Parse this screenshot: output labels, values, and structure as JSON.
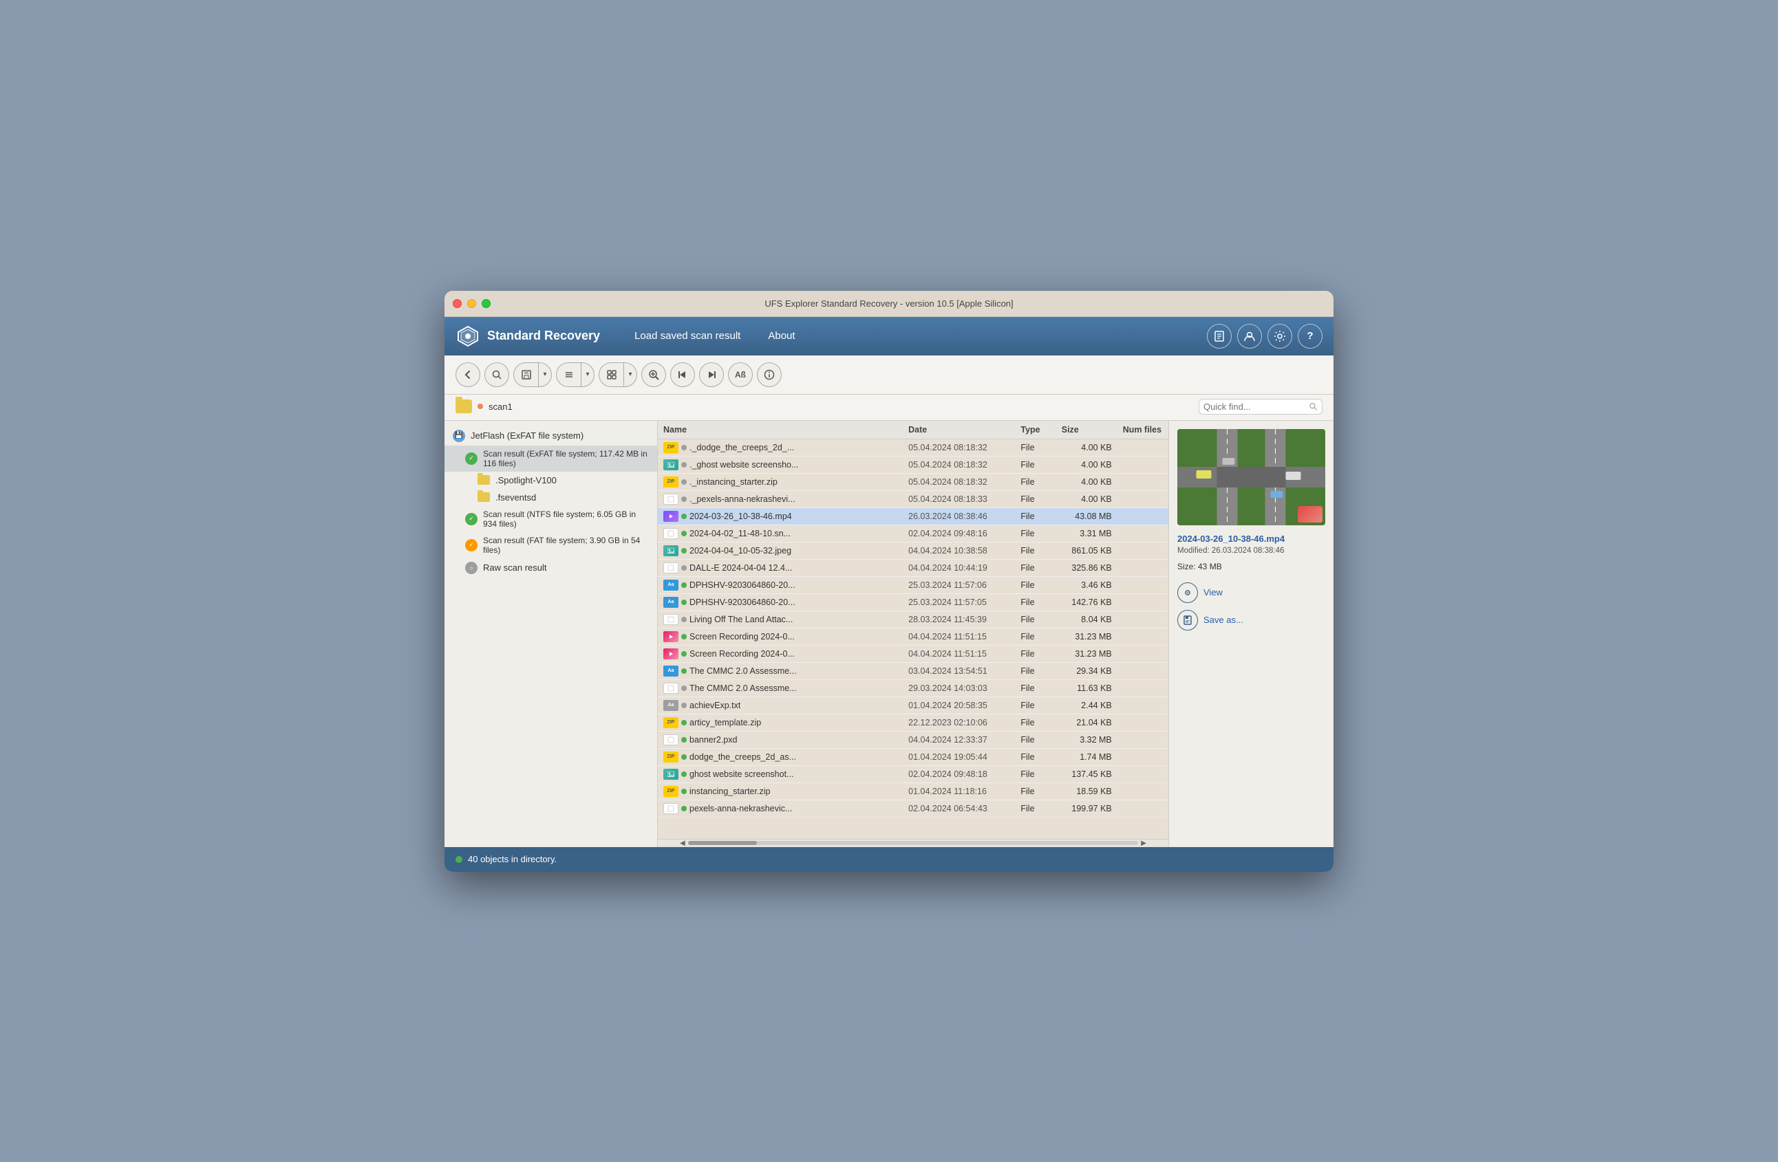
{
  "window": {
    "title": "UFS Explorer Standard Recovery - version 10.5 [Apple Silicon]"
  },
  "menubar": {
    "logo_text": "Standard Recovery",
    "items": [
      {
        "id": "load-scan",
        "label": "Load saved scan result"
      },
      {
        "id": "about",
        "label": "About"
      }
    ],
    "right_icons": [
      {
        "id": "docs-icon",
        "symbol": "📋"
      },
      {
        "id": "user-icon",
        "symbol": "👤"
      },
      {
        "id": "settings-icon",
        "symbol": "⚙"
      },
      {
        "id": "help-icon",
        "symbol": "?"
      }
    ]
  },
  "toolbar": {
    "buttons": [
      {
        "id": "back-btn",
        "symbol": "←"
      },
      {
        "id": "search-btn",
        "symbol": "🔍"
      },
      {
        "id": "save-btn",
        "symbol": "💾"
      },
      {
        "id": "list-btn",
        "symbol": "☰"
      },
      {
        "id": "view-btn",
        "symbol": "⊞"
      },
      {
        "id": "find-btn",
        "symbol": "🔎"
      },
      {
        "id": "prev-btn",
        "symbol": "⏮"
      },
      {
        "id": "next-btn",
        "symbol": "⏭"
      },
      {
        "id": "font-btn",
        "symbol": "Aß"
      },
      {
        "id": "info-btn",
        "symbol": "ℹ"
      }
    ]
  },
  "pathbar": {
    "path_name": "scan1",
    "search_placeholder": "Quick find..."
  },
  "sidebar": {
    "items": [
      {
        "id": "jetflash",
        "label": "JetFlash (ExFAT file system)",
        "icon_type": "disk",
        "indent": 0
      },
      {
        "id": "scan-exfat",
        "label": "Scan result (ExFAT file system; 117.42 MB in 116 files)",
        "icon_type": "green",
        "indent": 1
      },
      {
        "id": "spotlight",
        "label": ".Spotlight-V100",
        "icon_type": "folder",
        "indent": 2
      },
      {
        "id": "fseventsd",
        "label": ".fseventsd",
        "icon_type": "folder",
        "indent": 2
      },
      {
        "id": "scan-ntfs",
        "label": "Scan result (NTFS file system; 6.05 GB in 934 files)",
        "icon_type": "green",
        "indent": 1
      },
      {
        "id": "scan-fat",
        "label": "Scan result (FAT file system; 3.90 GB in 54 files)",
        "icon_type": "orange",
        "indent": 1
      },
      {
        "id": "raw-scan",
        "label": "Raw scan result",
        "icon_type": "gray",
        "indent": 1
      }
    ]
  },
  "file_table": {
    "columns": [
      "Name",
      "Date",
      "Type",
      "Size",
      "Num files"
    ],
    "rows": [
      {
        "name": "._dodge_the_creeps_2d_...",
        "thumb": "zip",
        "date": "05.04.2024 08:18:32",
        "type": "File",
        "size": "4.00 KB",
        "num_files": "",
        "dot": "gray",
        "selected": false
      },
      {
        "name": "._ghost website screensho...",
        "thumb": "photo",
        "date": "05.04.2024 08:18:32",
        "type": "File",
        "size": "4.00 KB",
        "num_files": "",
        "dot": "gray",
        "selected": false
      },
      {
        "name": "._instancing_starter.zip",
        "thumb": "zip",
        "date": "05.04.2024 08:18:32",
        "type": "File",
        "size": "4.00 KB",
        "num_files": "",
        "dot": "gray",
        "selected": false
      },
      {
        "name": "._pexels-anna-nekrashevi...",
        "thumb": "doc",
        "date": "05.04.2024 08:18:33",
        "type": "File",
        "size": "4.00 KB",
        "num_files": "",
        "dot": "gray",
        "selected": false
      },
      {
        "name": "2024-03-26_10-38-46.mp4",
        "thumb": "video",
        "date": "26.03.2024 08:38:46",
        "type": "File",
        "size": "43.08 MB",
        "num_files": "",
        "dot": "green",
        "selected": true
      },
      {
        "name": "2024-04-02_11-48-10.sn...",
        "thumb": "doc",
        "date": "02.04.2024 09:48:16",
        "type": "File",
        "size": "3.31 MB",
        "num_files": "",
        "dot": "green",
        "selected": false
      },
      {
        "name": "2024-04-04_10-05-32.jpeg",
        "thumb": "photo",
        "date": "04.04.2024 10:38:58",
        "type": "File",
        "size": "861.05 KB",
        "num_files": "",
        "dot": "green",
        "selected": false
      },
      {
        "name": "DALL-E 2024-04-04 12.4...",
        "thumb": "doc",
        "date": "04.04.2024 10:44:19",
        "type": "File",
        "size": "325.86 KB",
        "num_files": "",
        "dot": "gray",
        "selected": false
      },
      {
        "name": "DPHSHV-9203064860-20...",
        "thumb": "aa",
        "date": "25.03.2024 11:57:06",
        "type": "File",
        "size": "3.46 KB",
        "num_files": "",
        "dot": "green",
        "selected": false
      },
      {
        "name": "DPHSHV-9203064860-20...",
        "thumb": "aa",
        "date": "25.03.2024 11:57:05",
        "type": "File",
        "size": "142.76 KB",
        "num_files": "",
        "dot": "green",
        "selected": false
      },
      {
        "name": "Living Off The Land Attac...",
        "thumb": "doc",
        "date": "28.03.2024 11:45:39",
        "type": "File",
        "size": "8.04 KB",
        "num_files": "",
        "dot": "gray",
        "selected": false
      },
      {
        "name": "Screen Recording 2024-0...",
        "thumb": "video-pink",
        "date": "04.04.2024 11:51:15",
        "type": "File",
        "size": "31.23 MB",
        "num_files": "",
        "dot": "green",
        "selected": false
      },
      {
        "name": "Screen Recording 2024-0...",
        "thumb": "video-pink",
        "date": "04.04.2024 11:51:15",
        "type": "File",
        "size": "31.23 MB",
        "num_files": "",
        "dot": "green",
        "selected": false
      },
      {
        "name": "The CMMC 2.0 Assessme...",
        "thumb": "aa",
        "date": "03.04.2024 13:54:51",
        "type": "File",
        "size": "29.34 KB",
        "num_files": "",
        "dot": "green",
        "selected": false
      },
      {
        "name": "The CMMC 2.0 Assessme...",
        "thumb": "doc",
        "date": "29.03.2024 14:03:03",
        "type": "File",
        "size": "11.63 KB",
        "num_files": "",
        "dot": "gray",
        "selected": false
      },
      {
        "name": "achievExp.txt",
        "thumb": "aa-gray",
        "date": "01.04.2024 20:58:35",
        "type": "File",
        "size": "2.44 KB",
        "num_files": "",
        "dot": "gray",
        "selected": false
      },
      {
        "name": "articy_template.zip",
        "thumb": "zip",
        "date": "22.12.2023 02:10:06",
        "type": "File",
        "size": "21.04 KB",
        "num_files": "",
        "dot": "green",
        "selected": false
      },
      {
        "name": "banner2.pxd",
        "thumb": "doc",
        "date": "04.04.2024 12:33:37",
        "type": "File",
        "size": "3.32 MB",
        "num_files": "",
        "dot": "green",
        "selected": false
      },
      {
        "name": "dodge_the_creeps_2d_as...",
        "thumb": "zip",
        "date": "01.04.2024 19:05:44",
        "type": "File",
        "size": "1.74 MB",
        "num_files": "",
        "dot": "green",
        "selected": false
      },
      {
        "name": "ghost website screenshot...",
        "thumb": "photo",
        "date": "02.04.2024 09:48:18",
        "type": "File",
        "size": "137.45 KB",
        "num_files": "",
        "dot": "green",
        "selected": false
      },
      {
        "name": "instancing_starter.zip",
        "thumb": "zip",
        "date": "01.04.2024 11:18:16",
        "type": "File",
        "size": "18.59 KB",
        "num_files": "",
        "dot": "green",
        "selected": false
      },
      {
        "name": "pexels-anna-nekrashevic...",
        "thumb": "doc",
        "date": "02.04.2024 06:54:43",
        "type": "File",
        "size": "199.97 KB",
        "num_files": "",
        "dot": "green",
        "selected": false
      }
    ]
  },
  "preview": {
    "filename": "2024-03-26_10-38-46.mp4",
    "modified_label": "Modified: 26.03.2024 08:38:46",
    "size_label": "Size: 43 MB",
    "view_label": "View",
    "save_as_label": "Save as..."
  },
  "statusbar": {
    "text": "40 objects in directory."
  }
}
